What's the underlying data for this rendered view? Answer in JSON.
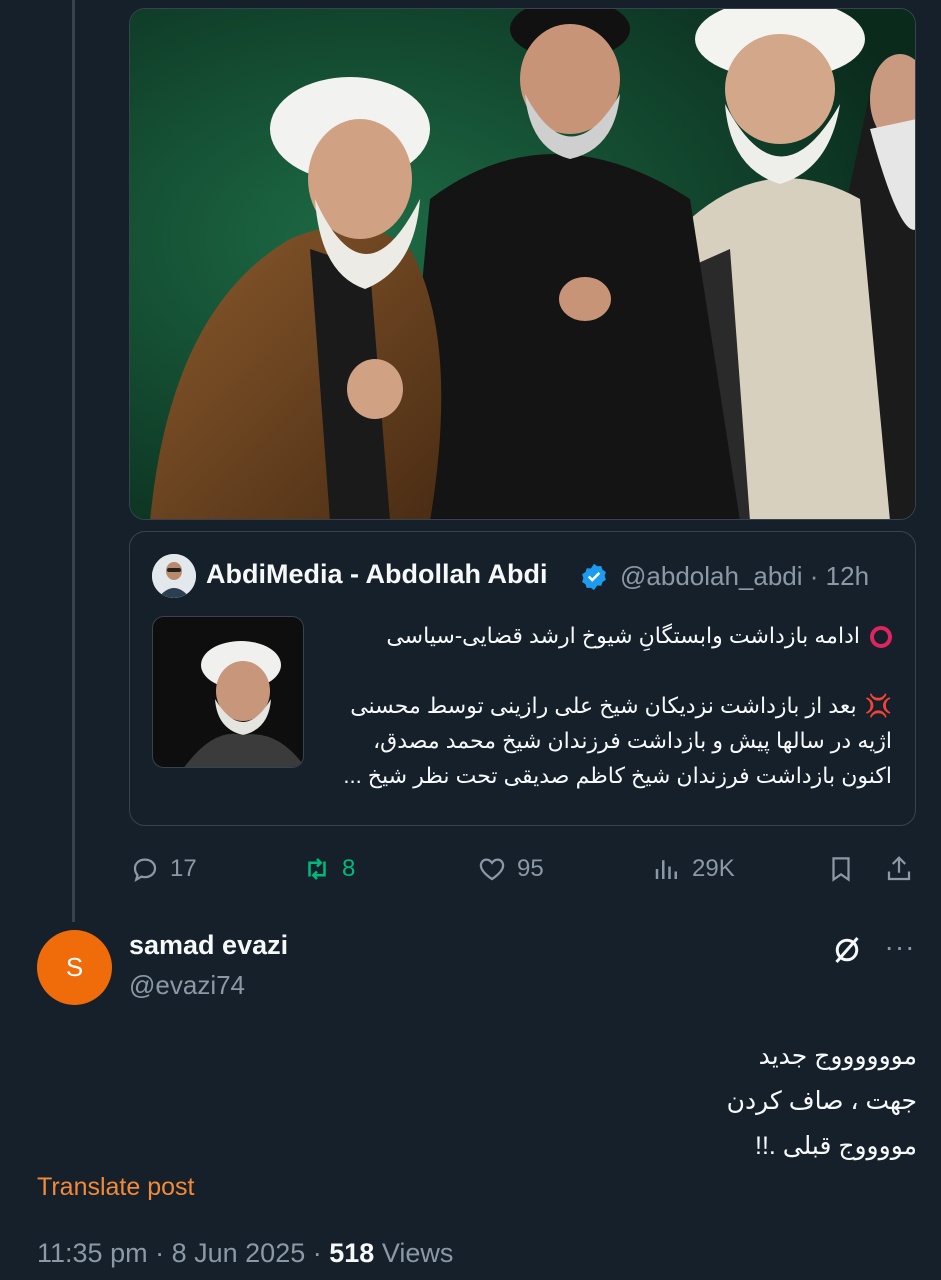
{
  "colors": {
    "background": "#15202b",
    "text_primary": "#f7f9f9",
    "text_secondary": "#8b98a5",
    "retweet_active": "#00ba7c",
    "verified_blue": "#1d9bf0",
    "avatar_orange": "#f06b0a",
    "translate_link": "#f28a3a"
  },
  "quoted_tweet": {
    "author_name": "AbdiMedia - Abdollah Abdi",
    "verified": true,
    "handle": "@abdolah_abdi",
    "time": "· 12h",
    "headline": "ادامه بازداشت وابستگانِ شیوخ ارشد قضایی-سیاسی",
    "body_line_1": "بعد از بازداشت نزدیکان شیخ علی رازینی توسط محسنی",
    "body_line_2": "اژیه در سالها پیش و بازداشت فرزندان شیخ محمد مصدق،",
    "body_line_3": "اکنون بازداشت فرزندان شیخ کاظم صدیقی تحت نظر شیخ ...",
    "headline_icon": "hollow-red-circle-icon",
    "body_icon": "anger-symbol-icon"
  },
  "actions": {
    "reply_count": "17",
    "retweet_count": "8",
    "like_count": "95",
    "view_count": "29K"
  },
  "reply": {
    "avatar_letter": "S",
    "name": "samad evazi",
    "handle": "@evazi74",
    "line_1": "مووووووج جدید",
    "line_2": "جهت ، صاف کردن",
    "line_3": "مووووج قبلی .!!",
    "translate_label": "Translate post",
    "time": "11:35 pm",
    "date": "8 Jun 2025",
    "views_count": "518",
    "views_label": "Views"
  }
}
